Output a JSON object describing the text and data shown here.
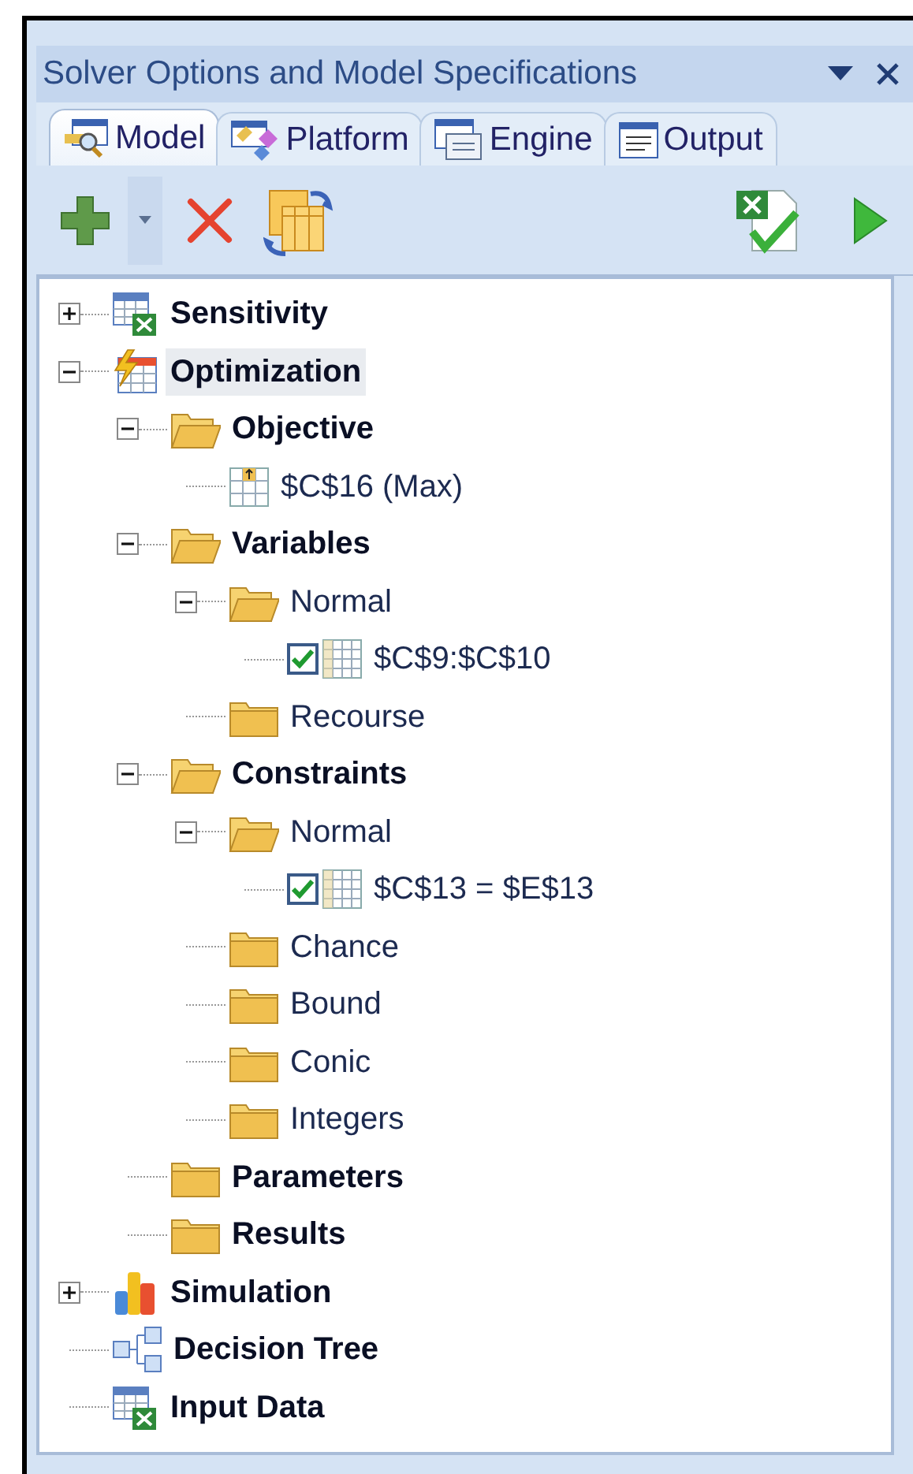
{
  "panel": {
    "title": "Solver Options and Model Specifications"
  },
  "tabs": [
    {
      "label": "Model",
      "kind": "model",
      "selected": true
    },
    {
      "label": "Platform",
      "kind": "platform",
      "selected": false
    },
    {
      "label": "Engine",
      "kind": "engine",
      "selected": false
    },
    {
      "label": "Output",
      "kind": "output",
      "selected": false
    }
  ],
  "tree": [
    {
      "label": "Sensitivity",
      "kind": "sheet",
      "bold": true,
      "expanded": false,
      "selected": false
    },
    {
      "label": "Optimization",
      "kind": "optimization",
      "bold": true,
      "expanded": true,
      "selected": true,
      "children": [
        {
          "label": "Objective",
          "kind": "folder",
          "bold": true,
          "expanded": true,
          "selected": false,
          "children": [
            {
              "label": "$C$16 (Max)",
              "kind": "objective-cell",
              "bold": false,
              "selected": false
            }
          ]
        },
        {
          "label": "Variables",
          "kind": "folder",
          "bold": true,
          "expanded": true,
          "selected": false,
          "children": [
            {
              "label": "Normal",
              "kind": "folder",
              "bold": false,
              "expanded": true,
              "selected": false,
              "children": [
                {
                  "label": "$C$9:$C$10",
                  "kind": "cells",
                  "bold": false,
                  "checked": true,
                  "selected": false
                }
              ]
            },
            {
              "label": "Recourse",
              "kind": "folder",
              "bold": false,
              "selected": false
            }
          ]
        },
        {
          "label": "Constraints",
          "kind": "folder",
          "bold": true,
          "expanded": true,
          "selected": false,
          "children": [
            {
              "label": "Normal",
              "kind": "folder",
              "bold": false,
              "expanded": true,
              "selected": false,
              "children": [
                {
                  "label": "$C$13 = $E$13",
                  "kind": "cells",
                  "bold": false,
                  "checked": true,
                  "selected": false
                }
              ]
            },
            {
              "label": "Chance",
              "kind": "folder",
              "bold": false,
              "selected": false
            },
            {
              "label": "Bound",
              "kind": "folder",
              "bold": false,
              "selected": false
            },
            {
              "label": "Conic",
              "kind": "folder",
              "bold": false,
              "selected": false
            },
            {
              "label": "Integers",
              "kind": "folder",
              "bold": false,
              "selected": false
            }
          ]
        },
        {
          "label": "Parameters",
          "kind": "folder",
          "bold": true,
          "selected": false
        },
        {
          "label": "Results",
          "kind": "folder",
          "bold": true,
          "selected": false
        }
      ]
    },
    {
      "label": "Simulation",
      "kind": "chart",
      "bold": true,
      "expanded": false,
      "selected": false
    },
    {
      "label": "Decision Tree",
      "kind": "decision-tree",
      "bold": true,
      "selected": false
    },
    {
      "label": "Input Data",
      "kind": "sheet",
      "bold": true,
      "selected": false
    }
  ]
}
